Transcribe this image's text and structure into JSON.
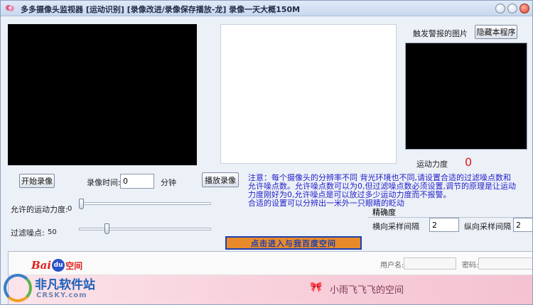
{
  "window": {
    "title": "多多摄像头监视器 [运动识别] [录像改进/录像保存播放-龙]  录像一天大概150M"
  },
  "alarm": {
    "label": "触发警报的图片",
    "hide_button": "隐藏本程序"
  },
  "motion": {
    "label": "运动力度",
    "value": "0"
  },
  "recording": {
    "start_button": "开始录像",
    "time_label": "录像时间:",
    "time_value": "0",
    "time_unit": "分钟",
    "play_button": "播放录像"
  },
  "note": {
    "lines": [
      "注意：每个摄像头的分辨率不同 背光环境也不同,请设置合适的过滤噪点数和",
      "允许噪点数。允许噪点数可以为0,但过滤噪点数必须设置,调节的原理是让运动",
      "力度刚好为0,允许噪点是可以放过多少运动力度而不报警。",
      "合适的设置可以分辨出一米外一只眼睛的眨动"
    ]
  },
  "sliders": {
    "motion_allowed": {
      "label": "允许的运动力度:",
      "value": "0",
      "fraction": 0.0
    },
    "noise_filter": {
      "label": "过滤噪点:",
      "value": "50",
      "fraction": 0.2
    }
  },
  "precision": {
    "title": "精确度",
    "h_label": "横向采样间隔",
    "h_value": "2",
    "v_label": "纵向采样间隔",
    "v_value": "2"
  },
  "baidu_link": "点击进入与我百度空间",
  "web": {
    "logo_bai": "Bai",
    "logo_du": "du",
    "logo_kongjian": "空间",
    "user_label": "用户名:",
    "pass_label": "密码:",
    "banner_title": "小雨飞飞飞的空间",
    "banner_bow": "🎀"
  },
  "watermark": {
    "title": "非凡软件站",
    "subtitle": "CRSKY.com"
  },
  "colors": {
    "note_text": "#2222c8",
    "motion_value": "#e01818",
    "link_bg": "#e98a2a",
    "link_border": "#1c3fb0"
  }
}
